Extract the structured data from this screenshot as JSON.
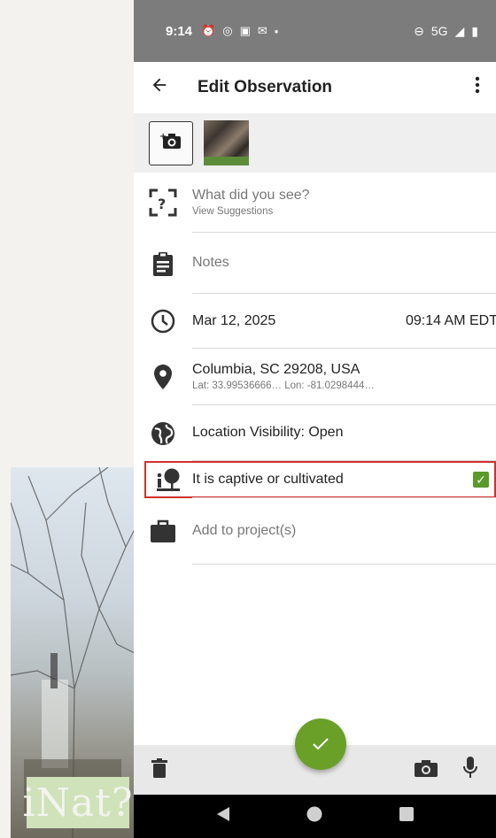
{
  "status_bar": {
    "time": "9:14",
    "network": "5G"
  },
  "app_bar": {
    "title": "Edit Observation"
  },
  "species": {
    "prompt": "What did you see?",
    "suggestions_link": "View Suggestions"
  },
  "notes": {
    "placeholder": "Notes"
  },
  "datetime": {
    "date": "Mar 12, 2025",
    "time": "09:14 AM EDT"
  },
  "location": {
    "place": "Columbia, SC 29208, USA",
    "coords": "Lat: 33.99536666… Lon: -81.0298444…"
  },
  "visibility": {
    "label": "Location Visibility: Open"
  },
  "captive": {
    "label": "It is captive or cultivated",
    "checked": true
  },
  "projects": {
    "label": "Add to project(s)"
  },
  "watermark": {
    "text": "iNat?"
  },
  "colors": {
    "accent": "#6aa028",
    "checkbox": "#5a9a2a",
    "highlight": "#d32f2f",
    "status_bar": "#7c7c7c"
  },
  "icons": [
    "back-arrow-icon",
    "overflow-menu-icon",
    "add-photo-icon",
    "species-scan-icon",
    "clipboard-icon",
    "clock-icon",
    "location-pin-icon",
    "globe-icon",
    "captive-plant-icon",
    "briefcase-icon",
    "check-icon",
    "trash-icon",
    "camera-icon",
    "microphone-icon"
  ]
}
